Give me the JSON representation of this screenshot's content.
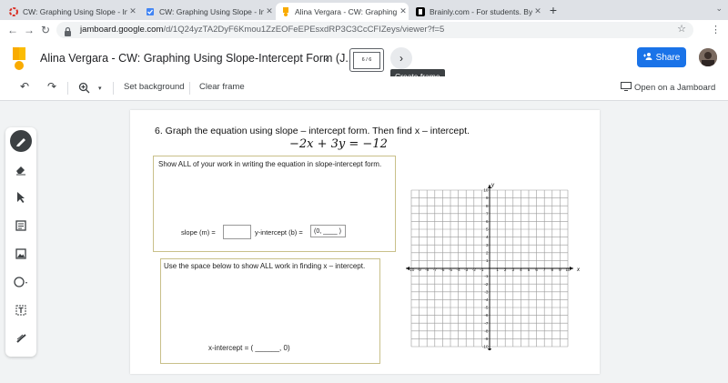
{
  "browser": {
    "tabs": [
      {
        "title": "CW: Graphing Using Slope - Inte",
        "icon": "google-classroom-icon",
        "active": false
      },
      {
        "title": "CW: Graphing Using Slope - Inte",
        "icon": "assignment-check-icon",
        "active": false
      },
      {
        "title": "Alina Vergara - CW: Graphing Us",
        "icon": "jamboard-icon",
        "active": true
      },
      {
        "title": "Brainly.com - For students. By st",
        "icon": "brainly-icon",
        "active": false
      }
    ],
    "new_tab": "+",
    "url_host": "jamboard.google.com",
    "url_path": "/d/1Q24yzTA2DyF6Kmou1ZzEOFeEPEsxdRP3C3CcCFIZeys/viewer?f=5"
  },
  "header": {
    "title": "Alina Vergara - CW: Graphing Using Slope-Intercept Form (J...",
    "frame_counter": "6 / 6",
    "tooltip": "Create frame",
    "share_label": "Share",
    "accent": "#1a73e8"
  },
  "toolbar": {
    "zoom_caret": "▾",
    "set_background": "Set background",
    "clear_frame": "Clear frame",
    "open_on_jamboard": "Open on a Jamboard"
  },
  "tools": [
    "pen-icon",
    "eraser-icon",
    "select-icon",
    "sticky-note-icon",
    "image-icon",
    "shape-icon",
    "text-box-icon",
    "laser-icon"
  ],
  "worksheet": {
    "question": "6.  Graph the equation using slope – intercept form.  Then find x – intercept.",
    "equation": "−2x + 3y = −12",
    "box1_prompt": "Show ALL of your work in writing the equation in slope-intercept form.",
    "slope_label": "slope (m) =",
    "yint_label": "y-intercept (b) =",
    "yint_value": "(0, ____ )",
    "box2_prompt": "Use the space below to show ALL work in finding x – intercept.",
    "xint_label": "x-intercept = ( ______, 0)"
  },
  "graph": {
    "x_axis_label": "x",
    "y_axis_label": "y",
    "x_ticks": [
      "-10",
      "-9",
      "-8",
      "-7",
      "-6",
      "-5",
      "-4",
      "-3",
      "-2",
      "-1",
      "1",
      "2",
      "3",
      "4",
      "5",
      "6",
      "7",
      "8",
      "9",
      "10"
    ],
    "y_ticks": [
      "10",
      "9",
      "8",
      "7",
      "6",
      "5",
      "4",
      "3",
      "2",
      "1",
      "-1",
      "-2",
      "-3",
      "-4",
      "-5",
      "-6",
      "-7",
      "-8",
      "-9",
      "-10"
    ],
    "range": [
      -10,
      10
    ]
  }
}
